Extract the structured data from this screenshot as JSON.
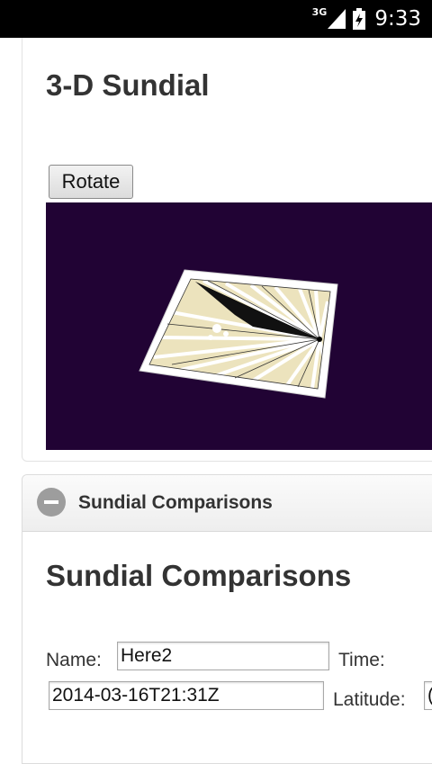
{
  "status_bar": {
    "network": "3G",
    "time": "9:33"
  },
  "sundial_panel": {
    "title": "3-D Sundial",
    "rotate_button": "Rotate",
    "canvas_background": "#210334"
  },
  "comparisons": {
    "header_label": "Sundial Comparisons",
    "section_title": "Sundial Comparisons",
    "name_label": "Name:",
    "name_value": "Here2",
    "time_label": "Time:",
    "time_value": "2014-03-16T21:31Z",
    "latitude_label": "Latitude:",
    "latitude_value": "("
  }
}
